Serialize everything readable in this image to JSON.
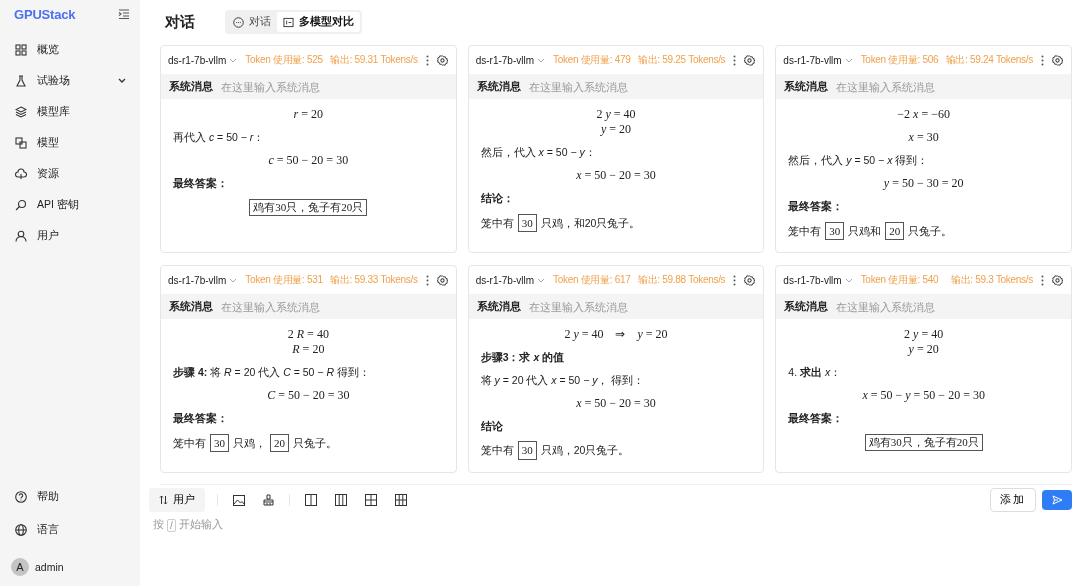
{
  "sidebar": {
    "logo": "GPUStack",
    "items": [
      {
        "label": "概览",
        "expandable": false
      },
      {
        "label": "试验场",
        "expandable": true
      },
      {
        "label": "模型库",
        "expandable": false
      },
      {
        "label": "模型",
        "expandable": false
      },
      {
        "label": "资源",
        "expandable": false
      },
      {
        "label": "API 密钥",
        "expandable": false
      },
      {
        "label": "用户",
        "expandable": false
      }
    ],
    "bottom_items": [
      {
        "label": "帮助"
      },
      {
        "label": "语言"
      }
    ],
    "user": {
      "avatar": "A",
      "name": "admin"
    }
  },
  "header": {
    "title": "对话",
    "tabs": [
      {
        "label": "对话",
        "selected": false
      },
      {
        "label": "多模型对比",
        "selected": true
      }
    ]
  },
  "panels": [
    {
      "model": "ds-r1-7b-vllm",
      "tokens": "Token 使用量: 525",
      "speed": "输出: 59.31 Tokens/s",
      "system_label": "系统消息",
      "system_placeholder": "在这里输入系统消息",
      "blocks": [
        {
          "kind": "math",
          "lines": [
            "*r* = 20"
          ]
        },
        {
          "kind": "text",
          "text": "再代入 *c* = 50 − *r*："
        },
        {
          "kind": "math",
          "lines": [
            "*c* = 50 − 20 = 30"
          ]
        },
        {
          "kind": "heading",
          "text": "最终答案："
        },
        {
          "kind": "answer",
          "text": "鸡有30只，兔子有20只"
        }
      ]
    },
    {
      "model": "ds-r1-7b-vllm",
      "tokens": "Token 使用量: 479",
      "speed": "输出: 59.25 Tokens/s",
      "system_label": "系统消息",
      "system_placeholder": "在这里输入系统消息",
      "blocks": [
        {
          "kind": "math",
          "lines": [
            "2 *y* = 40",
            "*y* = 20"
          ]
        },
        {
          "kind": "text",
          "text": "然后，代入 *x* = 50 − *y*："
        },
        {
          "kind": "math",
          "lines": [
            "*x* = 50 − 20 = 30"
          ]
        },
        {
          "kind": "heading",
          "text": "结论："
        },
        {
          "kind": "boxed_line",
          "parts": [
            {
              "text": "笼中有",
              "boxed": false
            },
            {
              "text": "30",
              "boxed": true
            },
            {
              "text": "只鸡，和20只兔子。",
              "boxed": false
            }
          ]
        }
      ]
    },
    {
      "model": "ds-r1-7b-vllm",
      "tokens": "Token 使用量: 506",
      "speed": "输出: 59.24 Tokens/s",
      "system_label": "系统消息",
      "system_placeholder": "在这里输入系统消息",
      "blocks": [
        {
          "kind": "math",
          "lines": [
            "−2 *x* = −60"
          ]
        },
        {
          "kind": "math",
          "lines": [
            "*x* = 30"
          ]
        },
        {
          "kind": "text",
          "text": "然后，代入 *y* = 50 − *x* 得到："
        },
        {
          "kind": "math",
          "lines": [
            "*y* = 50 − 30 = 20"
          ]
        },
        {
          "kind": "heading",
          "text": "最终答案："
        },
        {
          "kind": "boxed_line",
          "parts": [
            {
              "text": "笼中有",
              "boxed": false
            },
            {
              "text": "30",
              "boxed": true
            },
            {
              "text": "只鸡和",
              "boxed": false
            },
            {
              "text": "20",
              "boxed": true
            },
            {
              "text": "只兔子。",
              "boxed": false
            }
          ]
        }
      ]
    },
    {
      "model": "ds-r1-7b-vllm",
      "tokens": "Token 使用量: 531",
      "speed": "输出: 59.33 Tokens/s",
      "system_label": "系统消息",
      "system_placeholder": "在这里输入系统消息",
      "blocks": [
        {
          "kind": "math",
          "lines": [
            "2 *R* = 40",
            "*R* = 20"
          ]
        },
        {
          "kind": "text",
          "text": "**步骤 4:** 将 *R* = 20 代入 *C* = 50 − *R* 得到："
        },
        {
          "kind": "math",
          "lines": [
            "*C* = 50 − 20 = 30"
          ]
        },
        {
          "kind": "heading",
          "text": "最终答案："
        },
        {
          "kind": "boxed_line",
          "parts": [
            {
              "text": "笼中有",
              "boxed": false
            },
            {
              "text": "30",
              "boxed": true
            },
            {
              "text": "只鸡，",
              "boxed": false
            },
            {
              "text": "20",
              "boxed": true
            },
            {
              "text": "只兔子。",
              "boxed": false
            }
          ]
        }
      ]
    },
    {
      "model": "ds-r1-7b-vllm",
      "tokens": "Token 使用量: 617",
      "speed": "输出: 59.88 Tokens/s",
      "system_label": "系统消息",
      "system_placeholder": "在这里输入系统消息",
      "blocks": [
        {
          "kind": "math",
          "lines": [
            "2 *y* = 40    ⇒    *y* = 20"
          ]
        },
        {
          "kind": "heading",
          "text": "步骤3：求 *x* 的值"
        },
        {
          "kind": "text",
          "text": "将 *y* = 20 代入 *x* = 50 − *y*， 得到："
        },
        {
          "kind": "math",
          "lines": [
            "*x* = 50 − 20 = 30"
          ]
        },
        {
          "kind": "heading",
          "text": "结论"
        },
        {
          "kind": "boxed_line",
          "parts": [
            {
              "text": "笼中有",
              "boxed": false
            },
            {
              "text": "30",
              "boxed": true
            },
            {
              "text": "只鸡，20只兔子。",
              "boxed": false
            }
          ]
        }
      ]
    },
    {
      "model": "ds-r1-7b-vllm",
      "tokens": "Token 使用量: 540",
      "speed": "输出: 59.3 Tokens/s",
      "system_label": "系统消息",
      "system_placeholder": "在这里输入系统消息",
      "blocks": [
        {
          "kind": "math",
          "lines": [
            "2 *y* = 40",
            "*y* = 20"
          ]
        },
        {
          "kind": "text",
          "text": "4. **求出** *x*："
        },
        {
          "kind": "math",
          "lines": [
            "*x* = 50 − *y* = 50 − 20 = 30"
          ]
        },
        {
          "kind": "heading",
          "text": "最终答案："
        },
        {
          "kind": "answer",
          "text": "鸡有30只，兔子有20只"
        }
      ]
    }
  ],
  "composer": {
    "role_button": "用户",
    "placeholder_parts": [
      "按",
      "/",
      "开始输入"
    ],
    "add_button": "添加"
  }
}
